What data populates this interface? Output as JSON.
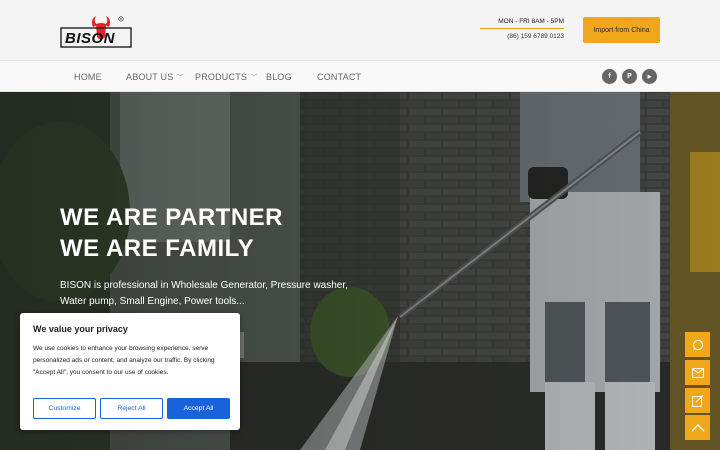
{
  "brand": {
    "name": "BISON",
    "registered_mark": "®",
    "accent_color": "#f0a81a",
    "logo_red": "#e32227"
  },
  "header": {
    "hours": "MON - FRI 8AM - 5PM",
    "phone": "(86) 159 6789 0123",
    "import_button": "Import from China"
  },
  "nav": {
    "items": [
      {
        "label": "HOME",
        "has_dropdown": false
      },
      {
        "label": "ABOUT US",
        "has_dropdown": true
      },
      {
        "label": "PRODUCTS",
        "has_dropdown": true
      },
      {
        "label": "BLOG",
        "has_dropdown": false
      },
      {
        "label": "CONTACT",
        "has_dropdown": false
      }
    ],
    "caret": "﹀",
    "social": [
      {
        "icon": "facebook-icon",
        "glyph": "f"
      },
      {
        "icon": "pinterest-icon",
        "glyph": "P"
      },
      {
        "icon": "youtube-icon",
        "glyph": "▶"
      }
    ]
  },
  "hero": {
    "title_line1": "WE ARE PARTNER",
    "title_line2": "WE ARE FAMILY",
    "text": "BISON is professional in Wholesale Generator, Pressure washer, Water pump, Small Engine, Power tools..."
  },
  "cookie": {
    "title": "We value your privacy",
    "text": "We use cookies to enhance your browsing experience, serve personalized ads or content, and analyze our traffic. By clicking \"Accept All\", you consent to our use of cookies.",
    "customize": "Customize",
    "reject": "Reject All",
    "accept": "Accept All",
    "button_color": "#1863dc"
  },
  "floating": [
    "whatsapp-icon",
    "email-icon",
    "inquiry-icon",
    "back-to-top-icon"
  ]
}
